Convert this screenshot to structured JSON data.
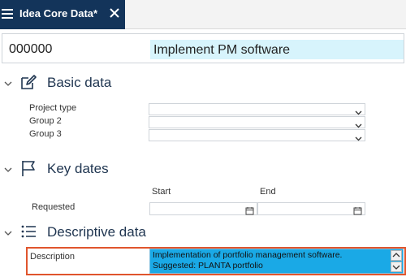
{
  "tab": {
    "title": "Idea Core Data*"
  },
  "record": {
    "id": "000000",
    "name": "Implement PM software"
  },
  "sections": {
    "basic": {
      "title": "Basic data",
      "fields": [
        {
          "label": "Project type",
          "value": ""
        },
        {
          "label": "Group 2",
          "value": ""
        },
        {
          "label": "Group 3",
          "value": ""
        }
      ]
    },
    "dates": {
      "title": "Key dates",
      "start_label": "Start",
      "end_label": "End",
      "row_label": "Requested",
      "start_value": "",
      "end_value": ""
    },
    "descriptive": {
      "title": "Descriptive data",
      "description_label": "Description",
      "description_line1": "Implementation of portfolio management software.",
      "description_line2": "Suggested: PLANTA portfolio"
    }
  },
  "colors": {
    "tab_bg": "#13345a",
    "name_bg": "#d7f4fc",
    "desc_bg": "#1aa9e6",
    "highlight": "#e0552d"
  }
}
